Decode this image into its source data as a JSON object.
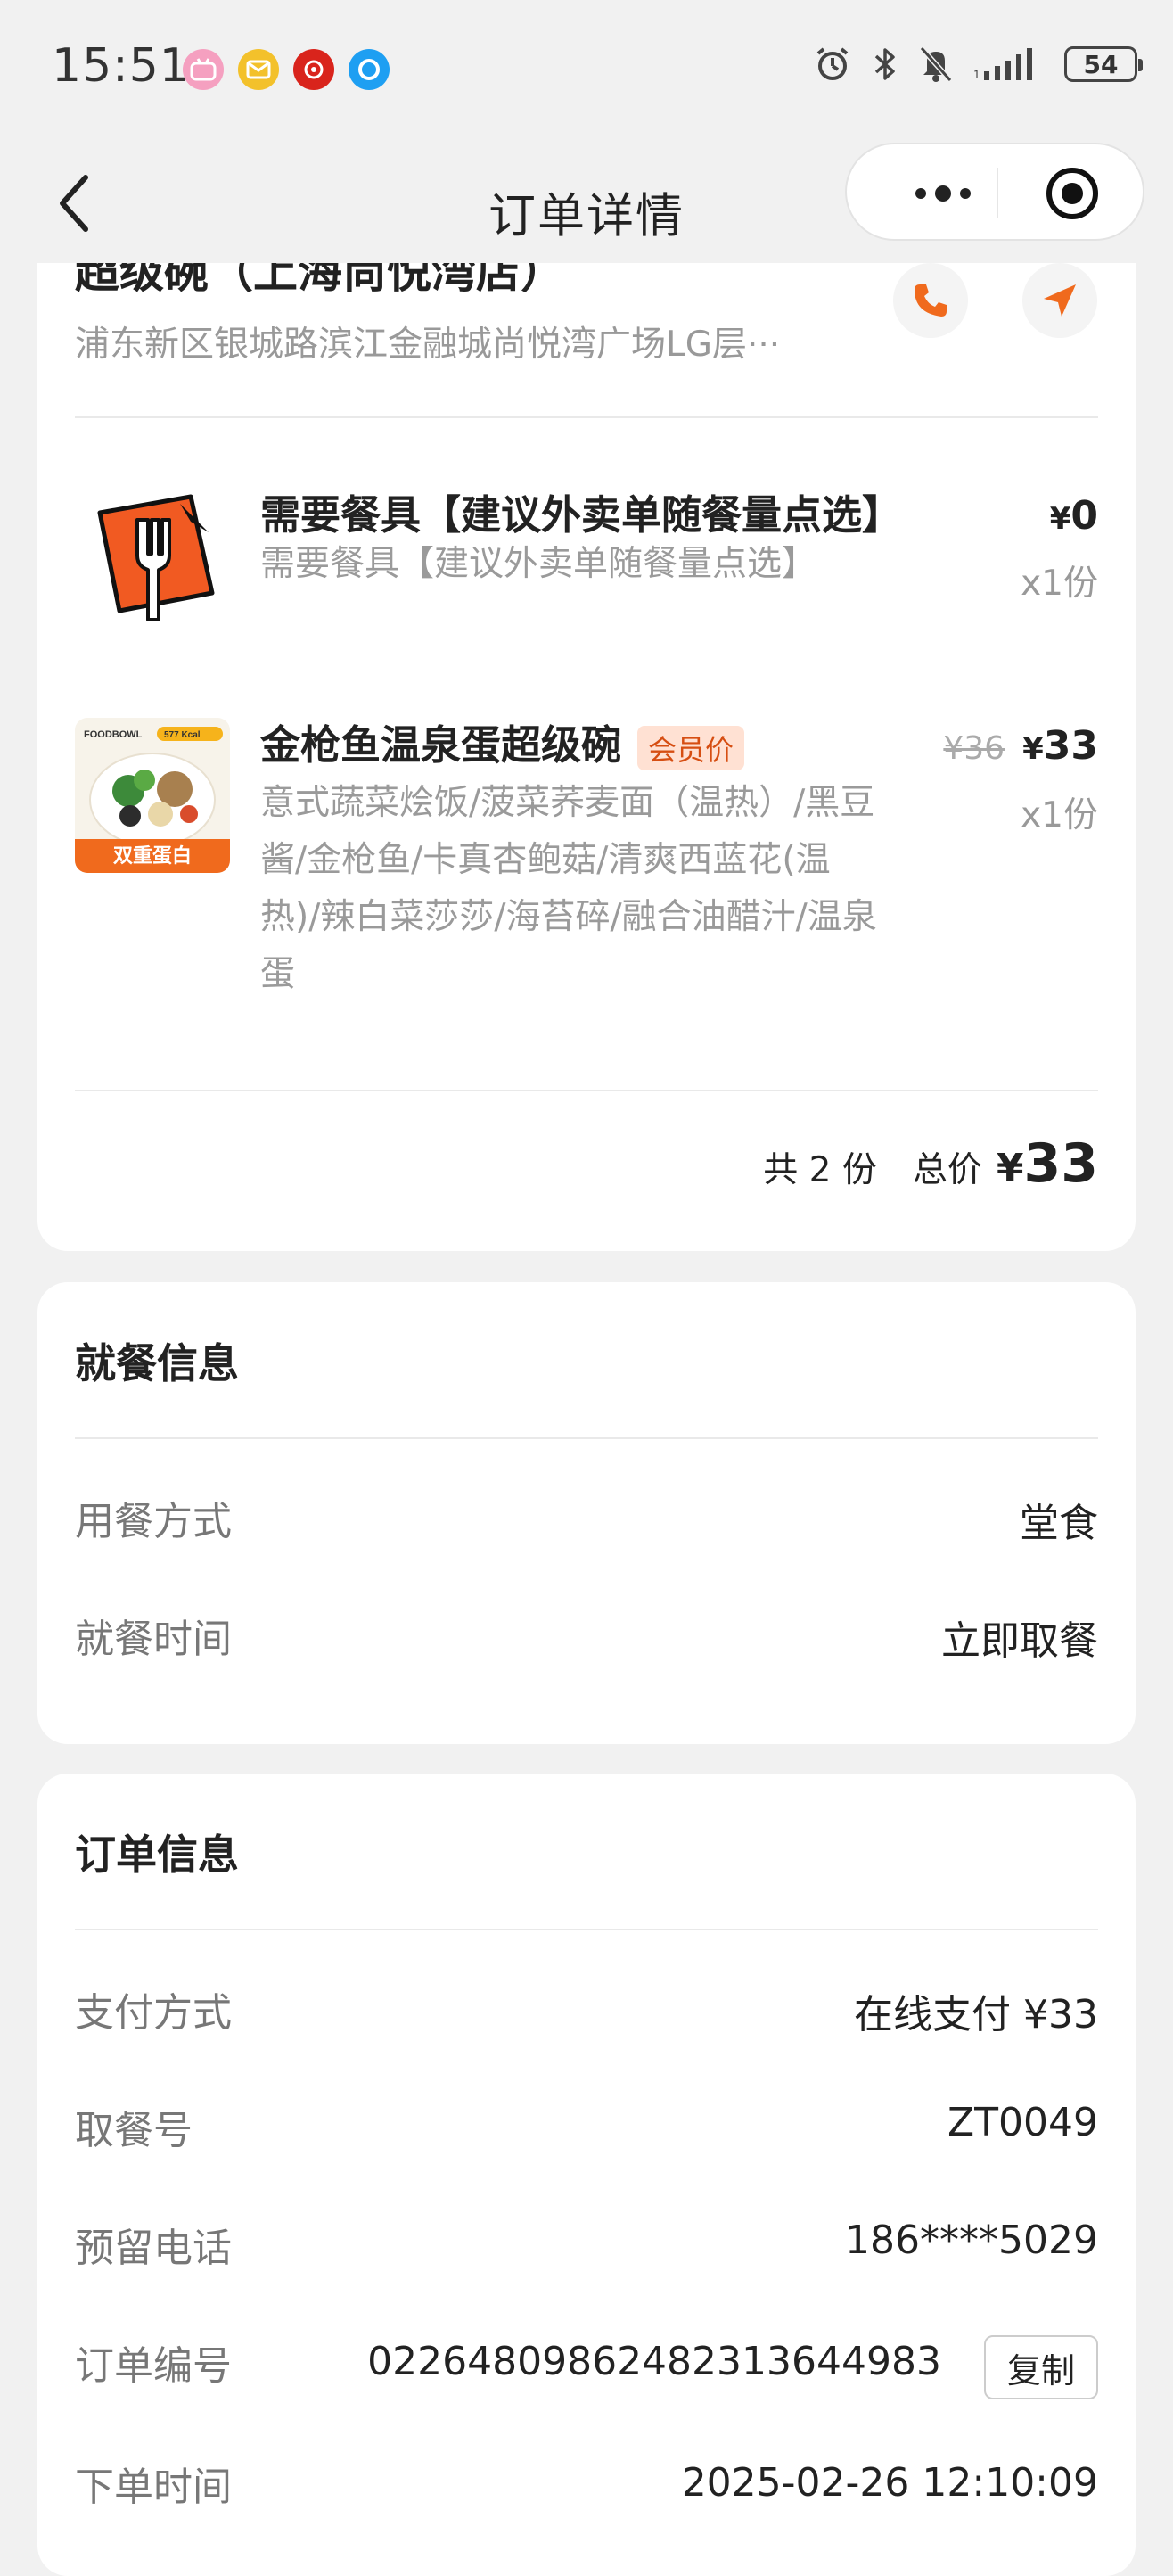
{
  "status_bar": {
    "time": "15:51",
    "battery": "54",
    "app_icons": [
      "bilibili-icon",
      "mail-icon",
      "netease-music-icon",
      "circle-app-icon"
    ],
    "icons": [
      "alarm-icon",
      "bluetooth-icon",
      "mute-icon",
      "signal-icon",
      "battery-icon"
    ]
  },
  "nav": {
    "title": "订单详情"
  },
  "store": {
    "name": "超级碗（上海尚悦湾店）",
    "address": "浦东新区银城路滨江金融城尚悦湾广场LG层···"
  },
  "items": [
    {
      "name": "需要餐具【建议外卖单随餐量点选】",
      "desc": "需要餐具【建议外卖单随餐量点选】",
      "currency": "¥",
      "price": "0",
      "qty": "x1份"
    },
    {
      "name": "金枪鱼温泉蛋超级碗",
      "badge": "会员价",
      "desc": "意式蔬菜烩饭/菠菜荞麦面（温热）/黑豆酱/金枪鱼/卡真杏鲍菇/清爽西蓝花(温热)/辣白菜莎莎/海苔碎/融合油醋汁/温泉蛋",
      "original_price": "¥36",
      "currency": "¥",
      "price": "33",
      "qty": "x1份",
      "image_text": {
        "brand": "FOODBOWL",
        "kcal": "577 Kcal",
        "tag": "双重蛋白"
      }
    }
  ],
  "summary": {
    "count": "共 2 份",
    "total_label": "总价",
    "currency": "¥",
    "total": "33"
  },
  "dining": {
    "title": "就餐信息",
    "rows": [
      {
        "label": "用餐方式",
        "value": "堂食"
      },
      {
        "label": "就餐时间",
        "value": "立即取餐"
      }
    ]
  },
  "order": {
    "title": "订单信息",
    "rows": [
      {
        "label": "支付方式",
        "value": "在线支付 ¥33"
      },
      {
        "label": "取餐号",
        "value": "ZT0049"
      },
      {
        "label": "预留电话",
        "value": "186****5029"
      },
      {
        "label": "订单编号",
        "value": "02264809862482313644983"
      },
      {
        "label": "下单时间",
        "value": "2025-02-26 12:10:09"
      }
    ],
    "copy_label": "复制"
  },
  "colors": {
    "accent": "#f06a1d",
    "background": "#f1f1f1",
    "card": "#ffffff"
  }
}
